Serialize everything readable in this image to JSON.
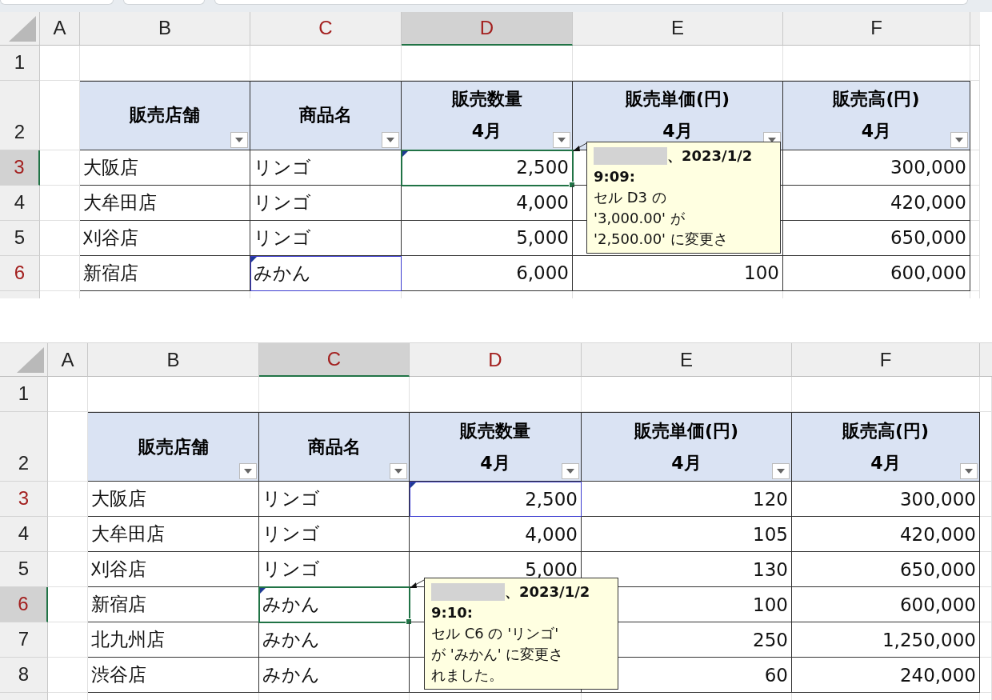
{
  "panels": [
    {
      "columns": [
        {
          "label": "A",
          "selected": false,
          "highlighted": false
        },
        {
          "label": "B",
          "selected": false,
          "highlighted": false
        },
        {
          "label": "C",
          "selected": false,
          "highlighted": true
        },
        {
          "label": "D",
          "selected": true,
          "highlighted": true
        },
        {
          "label": "E",
          "selected": false,
          "highlighted": false
        },
        {
          "label": "F",
          "selected": false,
          "highlighted": false
        }
      ],
      "rows": [
        {
          "kind": "blank",
          "label": "1",
          "selected": false,
          "highlighted": false
        },
        {
          "kind": "header",
          "label": "2",
          "selected": false,
          "highlighted": false,
          "cells": [
            {
              "title": "販売店舗"
            },
            {
              "title": "商品名"
            },
            {
              "title": "販売数量",
              "subtitle": "4月"
            },
            {
              "title": "販売単価(円)",
              "subtitle": "4月"
            },
            {
              "title": "販売高(円)",
              "subtitle": "4月"
            }
          ]
        },
        {
          "kind": "data",
          "label": "3",
          "selected": true,
          "highlighted": true,
          "cells": [
            {
              "text": "大阪店",
              "selected": false,
              "edited": false
            },
            {
              "text": "リンゴ",
              "selected": false,
              "edited": false
            },
            {
              "text": "2,500",
              "selected": true,
              "edited": true
            },
            null,
            {
              "text": "300,000",
              "selected": false,
              "edited": false
            }
          ]
        },
        {
          "kind": "data",
          "label": "4",
          "selected": false,
          "highlighted": false,
          "cells": [
            {
              "text": "大牟田店",
              "selected": false,
              "edited": false
            },
            {
              "text": "リンゴ",
              "selected": false,
              "edited": false
            },
            {
              "text": "4,000",
              "selected": false,
              "edited": false
            },
            null,
            {
              "text": "420,000",
              "selected": false,
              "edited": false
            }
          ]
        },
        {
          "kind": "data",
          "label": "5",
          "selected": false,
          "highlighted": false,
          "cells": [
            {
              "text": "刈谷店",
              "selected": false,
              "edited": false
            },
            {
              "text": "リンゴ",
              "selected": false,
              "edited": false
            },
            {
              "text": "5,000",
              "selected": false,
              "edited": false
            },
            null,
            {
              "text": "650,000",
              "selected": false,
              "edited": false
            }
          ]
        },
        {
          "kind": "data",
          "label": "6",
          "selected": false,
          "highlighted": true,
          "cells": [
            {
              "text": "新宿店",
              "selected": false,
              "edited": false
            },
            {
              "text": "みかん",
              "selected": false,
              "edited": true
            },
            {
              "text": "6,000",
              "selected": false,
              "edited": false
            },
            {
              "text": "100",
              "selected": false,
              "edited": false
            },
            {
              "text": "600,000",
              "selected": false,
              "edited": false
            }
          ]
        }
      ],
      "comment": {
        "lines": [
          {
            "text": "、2023/1/2",
            "bold": true
          },
          {
            "text": "9:09:",
            "bold": true
          },
          {
            "text": "セル D3 の",
            "bold": false
          },
          {
            "text": "'3,000.00' が",
            "bold": false
          },
          {
            "text": "'2,500.00' に変更さ",
            "bold": false
          }
        ]
      }
    },
    {
      "columns": [
        {
          "label": "A",
          "selected": false,
          "highlighted": false
        },
        {
          "label": "B",
          "selected": false,
          "highlighted": false
        },
        {
          "label": "C",
          "selected": true,
          "highlighted": true
        },
        {
          "label": "D",
          "selected": false,
          "highlighted": true
        },
        {
          "label": "E",
          "selected": false,
          "highlighted": false
        },
        {
          "label": "F",
          "selected": false,
          "highlighted": false
        }
      ],
      "rows": [
        {
          "kind": "blank",
          "label": "1",
          "selected": false,
          "highlighted": false
        },
        {
          "kind": "header",
          "label": "2",
          "selected": false,
          "highlighted": false,
          "cells": [
            {
              "title": "販売店舗"
            },
            {
              "title": "商品名"
            },
            {
              "title": "販売数量",
              "subtitle": "4月"
            },
            {
              "title": "販売単価(円)",
              "subtitle": "4月"
            },
            {
              "title": "販売高(円)",
              "subtitle": "4月"
            }
          ]
        },
        {
          "kind": "data",
          "label": "3",
          "selected": false,
          "highlighted": true,
          "cells": [
            {
              "text": "大阪店",
              "selected": false,
              "edited": false
            },
            {
              "text": "リンゴ",
              "selected": false,
              "edited": false
            },
            {
              "text": "2,500",
              "selected": false,
              "edited": true
            },
            {
              "text": "120",
              "selected": false,
              "edited": false
            },
            {
              "text": "300,000",
              "selected": false,
              "edited": false
            }
          ]
        },
        {
          "kind": "data",
          "label": "4",
          "selected": false,
          "highlighted": false,
          "cells": [
            {
              "text": "大牟田店",
              "selected": false,
              "edited": false
            },
            {
              "text": "リンゴ",
              "selected": false,
              "edited": false
            },
            {
              "text": "4,000",
              "selected": false,
              "edited": false
            },
            {
              "text": "105",
              "selected": false,
              "edited": false
            },
            {
              "text": "420,000",
              "selected": false,
              "edited": false
            }
          ]
        },
        {
          "kind": "data",
          "label": "5",
          "selected": false,
          "highlighted": false,
          "cells": [
            {
              "text": "刈谷店",
              "selected": false,
              "edited": false
            },
            {
              "text": "リンゴ",
              "selected": false,
              "edited": false
            },
            {
              "text": "5,000",
              "selected": false,
              "edited": false
            },
            {
              "text": "130",
              "selected": false,
              "edited": false
            },
            {
              "text": "650,000",
              "selected": false,
              "edited": false
            }
          ]
        },
        {
          "kind": "data",
          "label": "6",
          "selected": true,
          "highlighted": true,
          "cells": [
            {
              "text": "新宿店",
              "selected": false,
              "edited": false
            },
            {
              "text": "みかん",
              "selected": true,
              "edited": true
            },
            null,
            {
              "text": "100",
              "selected": false,
              "edited": false
            },
            {
              "text": "600,000",
              "selected": false,
              "edited": false
            }
          ]
        },
        {
          "kind": "data",
          "label": "7",
          "selected": false,
          "highlighted": false,
          "cells": [
            {
              "text": "北九州店",
              "selected": false,
              "edited": false
            },
            {
              "text": "みかん",
              "selected": false,
              "edited": false
            },
            null,
            {
              "text": "250",
              "selected": false,
              "edited": false
            },
            {
              "text": "1,250,000",
              "selected": false,
              "edited": false
            }
          ]
        },
        {
          "kind": "data",
          "label": "8",
          "selected": false,
          "highlighted": false,
          "cells": [
            {
              "text": "渋谷店",
              "selected": false,
              "edited": false
            },
            {
              "text": "みかん",
              "selected": false,
              "edited": false
            },
            null,
            {
              "text": "60",
              "selected": false,
              "edited": false
            },
            {
              "text": "240,000",
              "selected": false,
              "edited": false
            }
          ]
        }
      ],
      "comment": {
        "lines": [
          {
            "text": "、2023/1/2",
            "bold": true
          },
          {
            "text": "9:10:",
            "bold": true
          },
          {
            "text": "セル C6 の 'リンゴ'",
            "bold": false
          },
          {
            "text": "が 'みかん' に変更さ",
            "bold": false
          },
          {
            "text": "れました。",
            "bold": false
          }
        ]
      }
    }
  ]
}
